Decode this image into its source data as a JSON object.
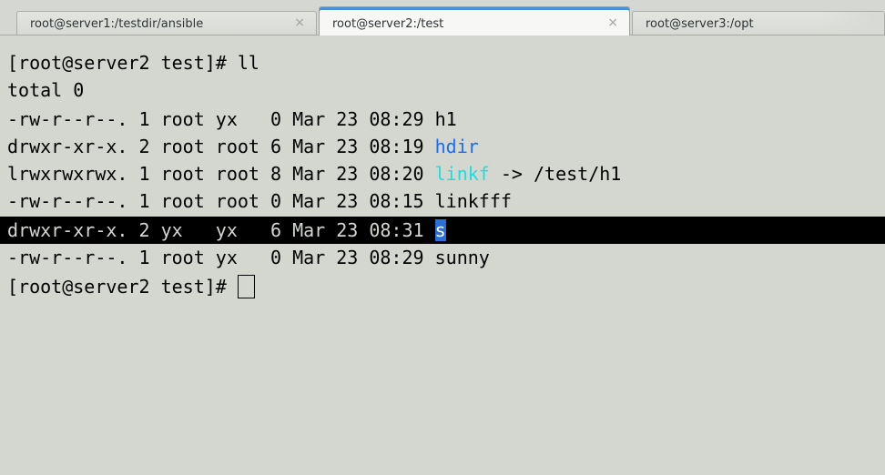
{
  "tabs": [
    {
      "label": "root@server1:/testdir/ansible",
      "close": "×"
    },
    {
      "label": "root@server2:/test",
      "close": "×"
    },
    {
      "label": "root@server3:/opt"
    }
  ],
  "terminal": {
    "prompt_cmd": "[root@server2 test]# ll",
    "total": "total 0",
    "entries": [
      {
        "prefix": "-rw-r--r--. 1 root yx   0 Mar 23 08:29 ",
        "name": "h1"
      },
      {
        "prefix": "drwxr-xr-x. 2 root root 6 Mar 23 08:19 ",
        "name": "hdir"
      },
      {
        "prefix": "lrwxrwxrwx. 1 root root 8 Mar 23 08:20 ",
        "name": "linkf",
        "target": " -> /test/h1"
      },
      {
        "prefix": "-rw-r--r--. 1 root root 0 Mar 23 08:15 ",
        "name": "linkfff"
      },
      {
        "prefix": "drwxr-xr-x. 2 yx   yx   6 Mar 23 08:31 ",
        "name": "s"
      },
      {
        "prefix": "-rw-r--r--. 1 root yx   0 Mar 23 08:29 ",
        "name": "sunny"
      }
    ],
    "final_prompt": "[root@server2 test]# "
  },
  "colors": {
    "background": "#d3d7cf",
    "directory": "#1a6df5",
    "symlink": "#16e0e0",
    "selection": "#000000",
    "tab_active_accent": "#4a90d9"
  },
  "icons": {
    "tab_close": "close-icon",
    "cursor": "block-cursor"
  }
}
